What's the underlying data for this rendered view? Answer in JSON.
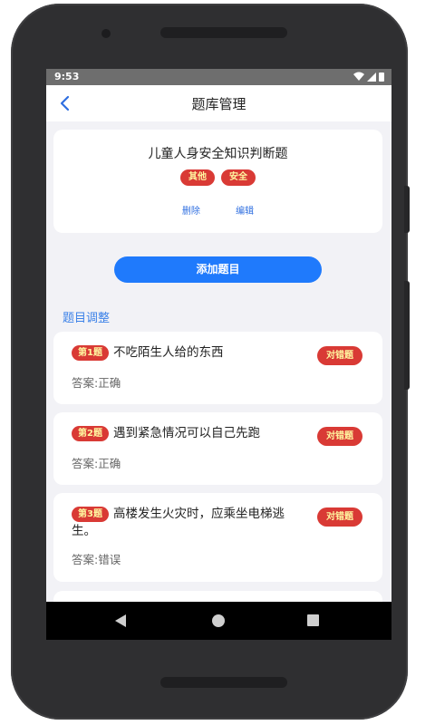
{
  "status": {
    "time": "9:53"
  },
  "nav": {
    "title": "题库管理"
  },
  "bank": {
    "title": "儿童人身安全知识判断题",
    "tags": [
      "其他",
      "安全"
    ],
    "delete_label": "删除",
    "edit_label": "编辑"
  },
  "add_button_label": "添加题目",
  "section_label": "题目调整",
  "questions": [
    {
      "badge": "第1题",
      "text": "不吃陌生人给的东西",
      "type": "对错题",
      "answer": "答案:正确"
    },
    {
      "badge": "第2题",
      "text": "遇到紧急情况可以自己先跑",
      "type": "对错题",
      "answer": "答案:正确"
    },
    {
      "badge": "第3题",
      "text": "高楼发生火灾时，应乘坐电梯逃生。",
      "type": "对错题",
      "answer": "答案:错误"
    }
  ],
  "colors": {
    "accent": "#1f7afc",
    "tag_bg": "#d93a35",
    "tag_text": "#fff7a0",
    "link": "#2f6fe0"
  }
}
